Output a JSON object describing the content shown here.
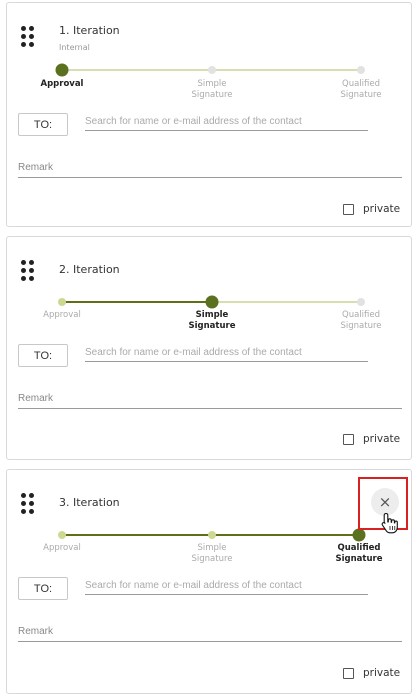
{
  "iterations": [
    {
      "title": "1. Iteration",
      "subtitle": "Internal",
      "steps": [
        {
          "label": "Approval",
          "state": "active"
        },
        {
          "label": "Simple Signature",
          "state": "future"
        },
        {
          "label": "Qualified Signature",
          "state": "future"
        }
      ],
      "to_label": "TO:",
      "search_placeholder": "Search for name or e-mail address of the contact",
      "remark_placeholder": "Remark",
      "private_label": "private"
    },
    {
      "title": "2. Iteration",
      "subtitle": "",
      "steps": [
        {
          "label": "Approval",
          "state": "done"
        },
        {
          "label": "Simple Signature",
          "state": "active"
        },
        {
          "label": "Qualified Signature",
          "state": "future"
        }
      ],
      "to_label": "TO:",
      "search_placeholder": "Search for name or e-mail address of the contact",
      "remark_placeholder": "Remark",
      "private_label": "private"
    },
    {
      "title": "3. Iteration",
      "subtitle": "",
      "steps": [
        {
          "label": "Approval",
          "state": "done"
        },
        {
          "label": "Simple Signature",
          "state": "done"
        },
        {
          "label": "Qualified Signature",
          "state": "active"
        }
      ],
      "to_label": "TO:",
      "search_placeholder": "Search for name or e-mail address of the contact",
      "remark_placeholder": "Remark",
      "private_label": "private"
    }
  ],
  "close_icon": "×",
  "colors": {
    "accent": "#5b7120",
    "done": "#cdd991",
    "future": "#e2e2e2",
    "highlight": "#d92121"
  }
}
